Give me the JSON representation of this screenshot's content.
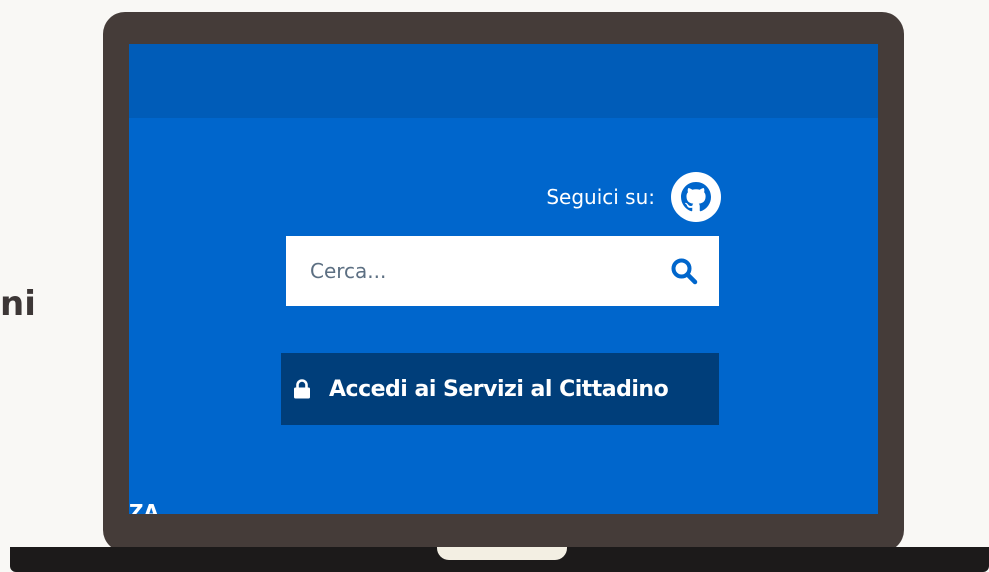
{
  "background_text": "ni",
  "header": {
    "follow_label": "Seguici su:",
    "social_icon": "github-icon"
  },
  "search": {
    "placeholder": "Cerca...",
    "icon": "search-icon"
  },
  "login": {
    "label": "Accedi ai Servizi al Cittadino",
    "icon": "lock-icon"
  },
  "clipped_text": "ZA",
  "colors": {
    "screen_blue": "#0066cc",
    "top_band_blue": "#005cb8",
    "button_dark_blue": "#003e7a",
    "laptop_frame": "#453c39",
    "laptop_base": "#1c1a1a",
    "page_background": "#f9f8f5"
  }
}
